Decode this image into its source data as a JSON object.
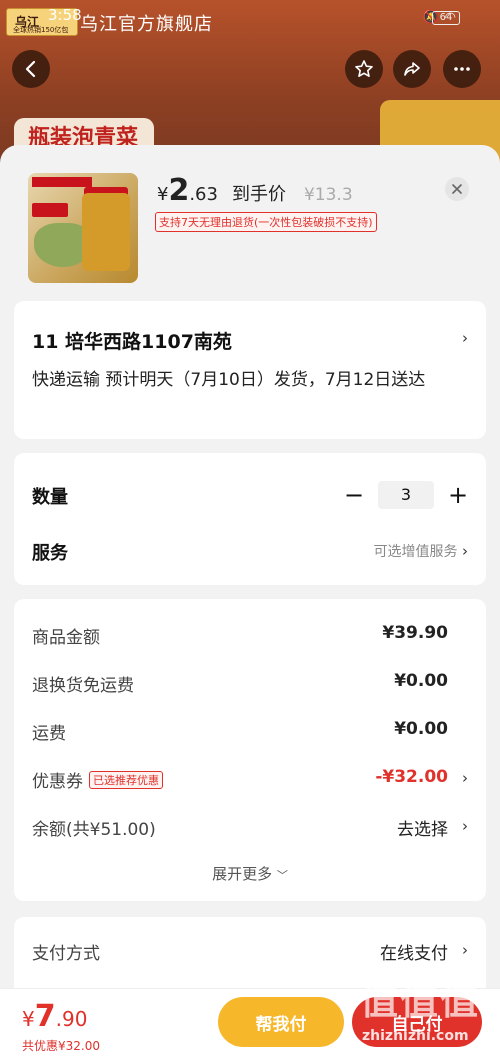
{
  "status_bar": {
    "time": "3:58",
    "battery": "64"
  },
  "brand_badge": {
    "name": "乌江",
    "sub": "全球热销150亿包"
  },
  "header": {
    "shop_title": "乌江官方旗舰店"
  },
  "background_card": {
    "label": "瓶装泡青菜"
  },
  "product": {
    "price_currency": "¥",
    "price_int": "2",
    "price_dec": ".63",
    "price_tag": "到手价",
    "original_price": "¥13.3",
    "refund_tag": "支持7天无理由退货(一次性包装破损不支持)"
  },
  "address": {
    "line": "11  培华西路1107南苑",
    "shipping": "快递运输 预计明天（7月10日）发货，7月12日送达"
  },
  "quantity": {
    "label": "数量",
    "value": "3",
    "minus": "−",
    "plus": "+"
  },
  "service": {
    "label": "服务",
    "value": "可选增值服务"
  },
  "costs": {
    "goods_label": "商品金额",
    "goods_value": "¥39.90",
    "return_label": "退换货免运费",
    "return_value": "¥0.00",
    "shipping_label": "运费",
    "shipping_value": "¥0.00",
    "coupon_label": "优惠券",
    "coupon_tag": "已选推荐优惠",
    "coupon_value": "-¥32.00",
    "balance_label": "余额(共¥51.00)",
    "balance_value": "去选择",
    "expand_label": "展开更多"
  },
  "payment": {
    "label": "支付方式",
    "value": "在线支付"
  },
  "bottom": {
    "total_currency": "¥",
    "total_int": "7",
    "total_dec": ".90",
    "total_saved": "共优惠¥32.00",
    "help_pay_label": "帮我付",
    "self_pay_label": "自己付"
  },
  "watermark": {
    "glyphs": "值值值",
    "url": "zhizhizhi.com"
  },
  "colors": {
    "accent_red": "#e0312b",
    "accent_yellow": "#f6b72a"
  }
}
